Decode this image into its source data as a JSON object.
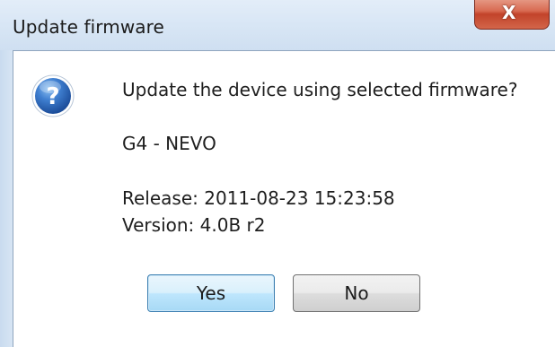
{
  "window": {
    "title": "Update firmware",
    "close_glyph": "X"
  },
  "icon": "question-icon",
  "message": {
    "question": "Update the device using selected firmware?",
    "device": "G4 - NEVO",
    "release": "Release:  2011-08-23 15:23:58",
    "version": "Version:  4.0B r2"
  },
  "buttons": {
    "yes": "Yes",
    "no": "No"
  },
  "colors": {
    "accent": "#3c7fb1",
    "close": "#c2432a",
    "icon": "#2a5fb0"
  }
}
